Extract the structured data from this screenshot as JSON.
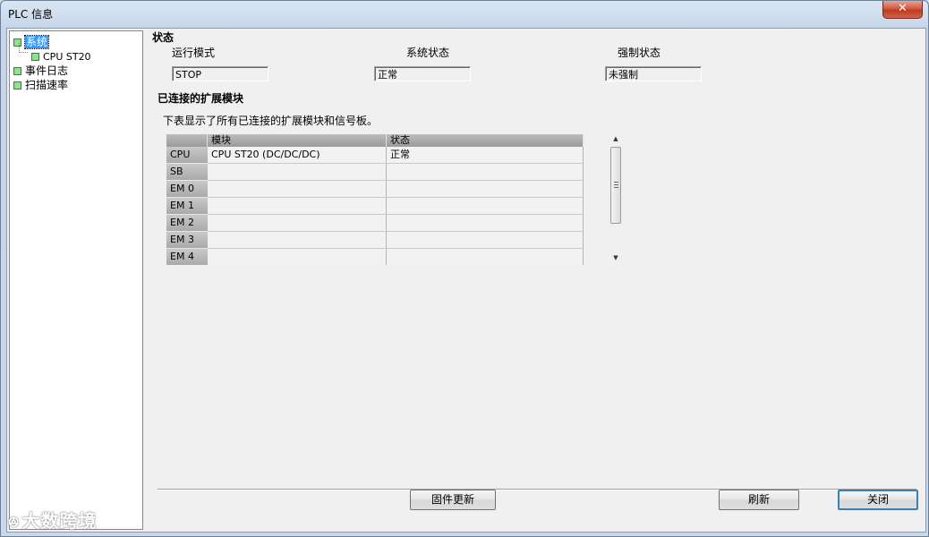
{
  "window": {
    "title": "PLC 信息",
    "close_glyph": "✕"
  },
  "tree": {
    "items": [
      {
        "label": "系统",
        "selected": true
      },
      {
        "label": "CPU ST20"
      },
      {
        "label": "事件日志"
      },
      {
        "label": "扫描速率"
      }
    ]
  },
  "status": {
    "title": "状态",
    "run_mode_label": "运行模式",
    "run_mode_value": "STOP",
    "system_status_label": "系统状态",
    "system_status_value": "正常",
    "force_status_label": "强制状态",
    "force_status_value": "未强制"
  },
  "modules": {
    "title": "已连接的扩展模块",
    "description": "下表显示了所有已连接的扩展模块和信号板。",
    "columns": [
      "",
      "模块",
      "状态"
    ],
    "rows": [
      {
        "slot": "CPU",
        "module": "CPU ST20 (DC/DC/DC)",
        "status": "正常"
      },
      {
        "slot": "SB",
        "module": "",
        "status": ""
      },
      {
        "slot": "EM 0",
        "module": "",
        "status": ""
      },
      {
        "slot": "EM 1",
        "module": "",
        "status": ""
      },
      {
        "slot": "EM 2",
        "module": "",
        "status": ""
      },
      {
        "slot": "EM 3",
        "module": "",
        "status": ""
      },
      {
        "slot": "EM 4",
        "module": "",
        "status": ""
      }
    ]
  },
  "scrollbar": {
    "up_glyph": "▲",
    "down_glyph": "▼"
  },
  "buttons": {
    "firmware_update": "固件更新",
    "refresh": "刷新",
    "close": "关闭"
  },
  "watermark": {
    "icon": "ꔮ",
    "text": "大数跨境"
  }
}
